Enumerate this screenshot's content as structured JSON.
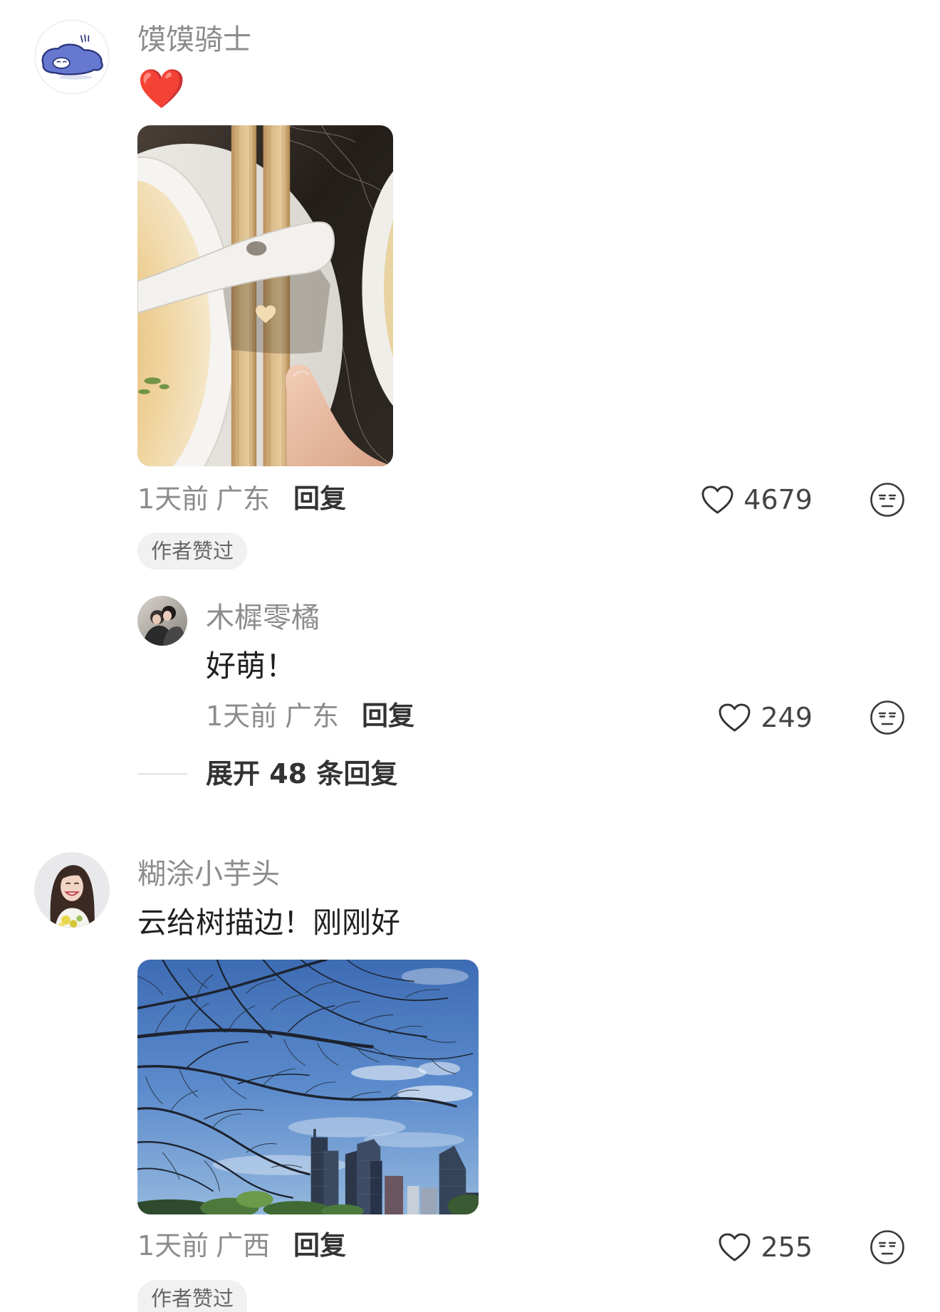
{
  "colors": {
    "username": "#8c8c8c",
    "text": "#1f1f1f",
    "meta": "#8c8c8c",
    "action": "#333333",
    "badge_bg": "#f1f1f1",
    "badge_text": "#666666",
    "heart_emoji": "#e0262c"
  },
  "icons": {
    "like": "heart-outline-icon",
    "dislike": "meh-face-icon"
  },
  "comments": [
    {
      "user": {
        "name": "馍馍骑士"
      },
      "text": "❤️",
      "time": "1天前",
      "location": "广东",
      "reply_label": "回复",
      "likes": 4679,
      "badge": "作者赞过",
      "replies": [
        {
          "user": {
            "name": "木樨零橘"
          },
          "text": "好萌！",
          "time": "1天前",
          "location": "广东",
          "reply_label": "回复",
          "likes": 249
        }
      ],
      "expand_label": "展开 48 条回复"
    },
    {
      "user": {
        "name": "糊涂小芋头"
      },
      "text": "云给树描边！刚刚好",
      "time": "1天前",
      "location": "广西",
      "reply_label": "回复",
      "likes": 255,
      "badge": "作者赞过"
    }
  ]
}
